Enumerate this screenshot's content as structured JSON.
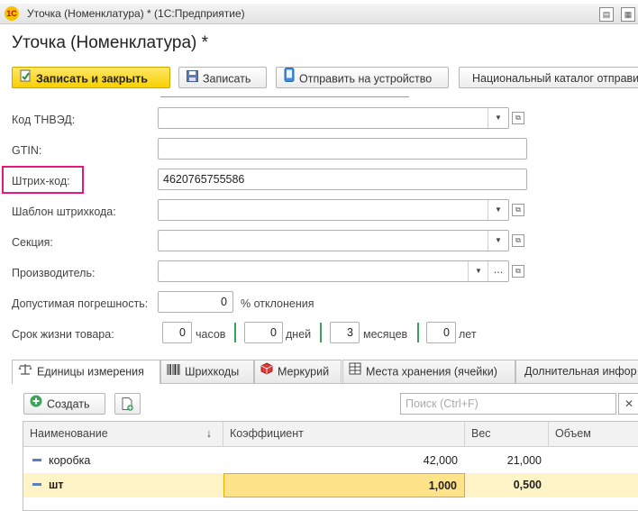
{
  "window": {
    "title": "Уточка (Номенклатура) * (1С:Предприятие)",
    "app_logo": "1С"
  },
  "form": {
    "title": "Уточка (Номенклатура) *"
  },
  "toolbar": {
    "save_close": "Записать и закрыть",
    "save": "Записать",
    "send_device": "Отправить на устройство",
    "national_catalog": "Национальный каталог отправи"
  },
  "fields": {
    "tnved_label": "Код ТНВЭД:",
    "gtin_label": "GTIN:",
    "barcode_label": "Штрих-код:",
    "barcode_value": "4620765755586",
    "barcode_template_label": "Шаблон штрихкода:",
    "section_label": "Секция:",
    "manufacturer_label": "Производитель:",
    "tolerance_label": "Допустимая погрешность:",
    "tolerance_value": "0",
    "tolerance_unit": "% отклонения",
    "shelf_life_label": "Срок жизни товара:",
    "hours_value": "0",
    "hours_unit": "часов",
    "days_value": "0",
    "days_unit": "дней",
    "months_value": "3",
    "months_unit": "месяцев",
    "years_value": "0",
    "years_unit": "лет"
  },
  "tabs": [
    "Единицы измерения",
    "Шрихкоды",
    "Меркурий",
    "Места хранения (ячейки)",
    "Долнительная инфор"
  ],
  "table": {
    "create_label": "Создать",
    "search_placeholder": "Поиск (Ctrl+F)",
    "columns": {
      "name": "Наименование",
      "sort_arrow": "↓",
      "coef": "Коэффициент",
      "weight": "Вес",
      "volume": "Объем"
    },
    "rows": [
      {
        "name": "коробка",
        "coef": "42,000",
        "weight": "21,000"
      },
      {
        "name": "шт",
        "coef": "1,000",
        "weight": "0,500"
      }
    ]
  },
  "colors": {
    "accent_yellow": "#f8d100",
    "highlight": "#e5187c",
    "selected_row": "#fff3c8",
    "selected_cell": "#ffe38a"
  }
}
